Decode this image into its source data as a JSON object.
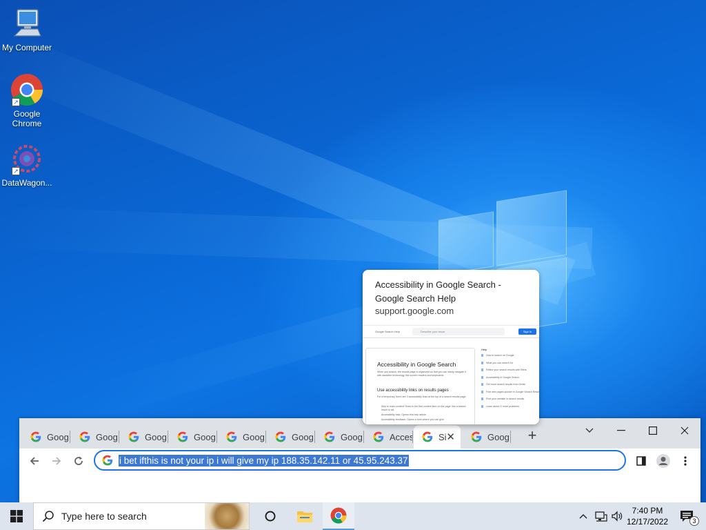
{
  "desktop": {
    "icons": [
      {
        "label": "My Computer"
      },
      {
        "label": "Google Chrome"
      },
      {
        "label": "DataWagon..."
      }
    ]
  },
  "hover_card": {
    "title": "Accessibility in Google Search - Google Search Help",
    "domain": "support.google.com",
    "thumbnail": {
      "brand": "Google Search Help",
      "search_placeholder": "Describe your issue",
      "signin": "Sign in",
      "heading": "Accessibility in Google Search",
      "intro": "When you search, the results page is organized so that you can easily navigate it with assistive technology, like screen readers and keyboards.",
      "subheading": "Use accessibility links on results pages",
      "body": "For a temporary, there are 3 accessibility links at the top of a search results page:",
      "bullet1": "Skip to main content: Goes to the first content item on the page, like a search result or ad.",
      "bullet2": "Accessibility help: Opens this help article.",
      "bullet3": "Accessibility feedback: Opens a form where you can give",
      "side_heading": "Help",
      "side_links": [
        "How to search on Google",
        "What you can search for",
        "Refine your search results with filters",
        "Accessibility in Google Search",
        "Get more search results from Gmail",
        "Fine web pages quicker in Google Search Results",
        "Find your website in search results",
        "Learn about G more problems"
      ]
    }
  },
  "chrome": {
    "tabs": [
      {
        "label": "Goog"
      },
      {
        "label": "Goog"
      },
      {
        "label": "Goog"
      },
      {
        "label": "Goog"
      },
      {
        "label": "Goog"
      },
      {
        "label": "Goog"
      },
      {
        "label": "Goog"
      },
      {
        "label": "Acces"
      },
      {
        "label": "Si",
        "active": true
      },
      {
        "label": "Goog"
      }
    ],
    "close_tab_glyph": "✕",
    "new_tab_glyph": "+",
    "omnibox_text": "i bet ifthis is not your ip i will give my ip 188.35.142.11 or 45.95.243.37"
  },
  "taskbar": {
    "search_placeholder": "Type here to search",
    "time": "7:40 PM",
    "date": "12/17/2022",
    "notification_count": "3"
  },
  "colors": {
    "accent": "#1a73e8",
    "tabstrip": "#dee1e6",
    "taskbar": "#dde4ed"
  }
}
